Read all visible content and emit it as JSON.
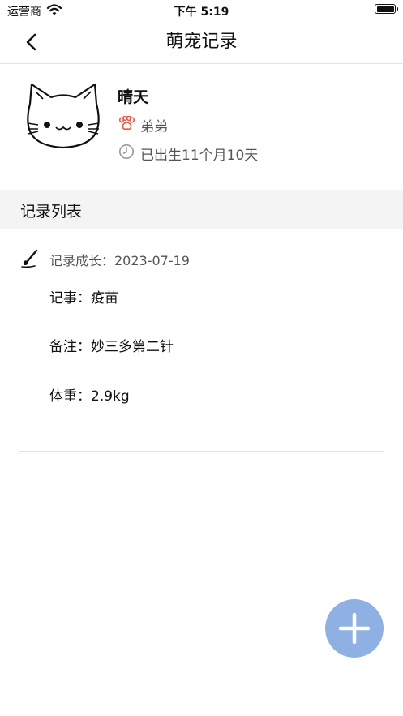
{
  "status_bar": {
    "carrier": "运营商",
    "time": "下午 5:19"
  },
  "nav": {
    "title": "萌宠记录"
  },
  "pet": {
    "name": "晴天",
    "gender": "弟弟",
    "age": "已出生11个月10天"
  },
  "records_section": {
    "title": "记录列表"
  },
  "records": [
    {
      "date_label": "记录成长：2023-07-19",
      "event": "记事：疫苗",
      "note": "备注：妙三多第二针",
      "weight": "体重：2.9kg"
    }
  ],
  "colors": {
    "accent_red": "#e8574a",
    "fab_blue": "#8fb0e2",
    "section_bg": "#f4f4f4"
  },
  "icons": [
    "wifi-icon",
    "battery-icon",
    "back-arrow-icon",
    "cat-avatar-icon",
    "paw-icon",
    "clock-icon",
    "pen-icon",
    "plus-icon"
  ]
}
